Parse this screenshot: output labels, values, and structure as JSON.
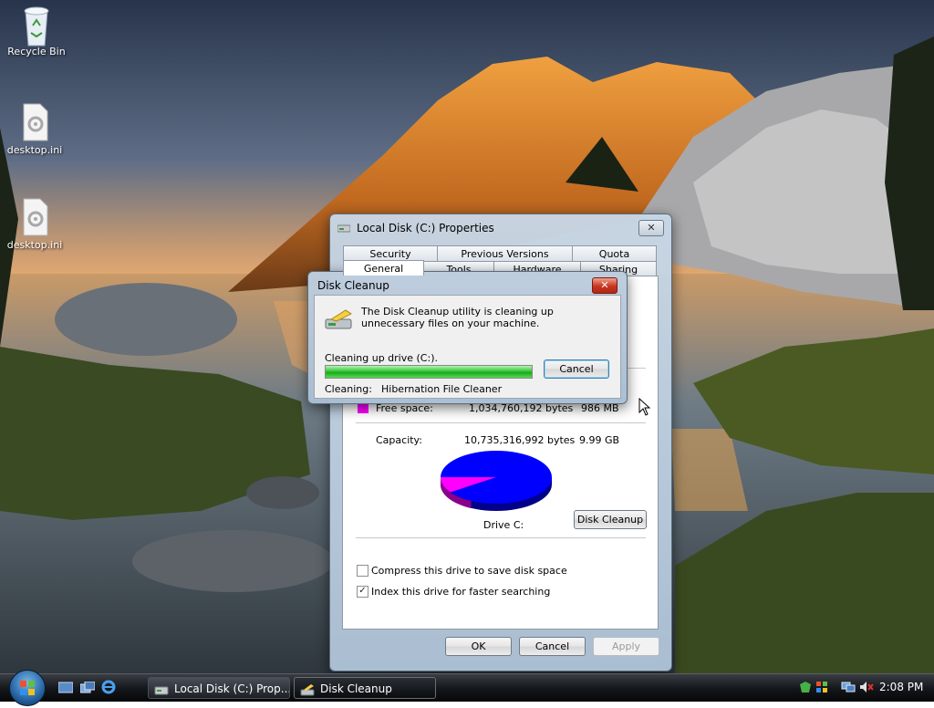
{
  "desktop": {
    "icons": [
      {
        "label": "Recycle Bin",
        "icon": "recycle-bin-icon"
      },
      {
        "label": "desktop.ini",
        "icon": "settings-file-icon"
      },
      {
        "label": "desktop.ini",
        "icon": "settings-file-icon"
      }
    ]
  },
  "properties": {
    "title": "Local Disk (C:) Properties",
    "tabs_row1": [
      "Security",
      "Previous Versions",
      "Quota"
    ],
    "tabs_row2": [
      "General",
      "Tools",
      "Hardware",
      "Sharing"
    ],
    "free_space_label": "Free space:",
    "free_space_bytes": "1,034,760,192 bytes",
    "free_space_size": "986 MB",
    "capacity_label": "Capacity:",
    "capacity_bytes": "10,735,316,992 bytes",
    "capacity_size": "9.99 GB",
    "drive_label": "Drive C:",
    "disk_cleanup_button": "Disk Cleanup",
    "compress_label": "Compress this drive to save disk space",
    "compress_checked": false,
    "index_label": "Index this drive for faster searching",
    "index_checked": true,
    "ok_button": "OK",
    "cancel_button": "Cancel",
    "apply_button": "Apply",
    "used_color": "#0000ff",
    "free_color": "#ff00ff",
    "used_fraction": 0.904
  },
  "cleanup_dialog": {
    "title": "Disk Cleanup",
    "message": "The Disk Cleanup utility is cleaning up unnecessary files on your machine.",
    "progress_label": "Cleaning up drive  (C:).",
    "progress_fraction": 1.0,
    "cancel_button": "Cancel",
    "cleaning_label": "Cleaning:",
    "cleaning_item": "Hibernation File Cleaner"
  },
  "taskbar": {
    "buttons": [
      {
        "label": "Local Disk (C:) Prop...",
        "icon": "drive-icon"
      },
      {
        "label": "Disk Cleanup",
        "icon": "disk-cleanup-icon"
      }
    ],
    "clock": "2:08 PM"
  }
}
